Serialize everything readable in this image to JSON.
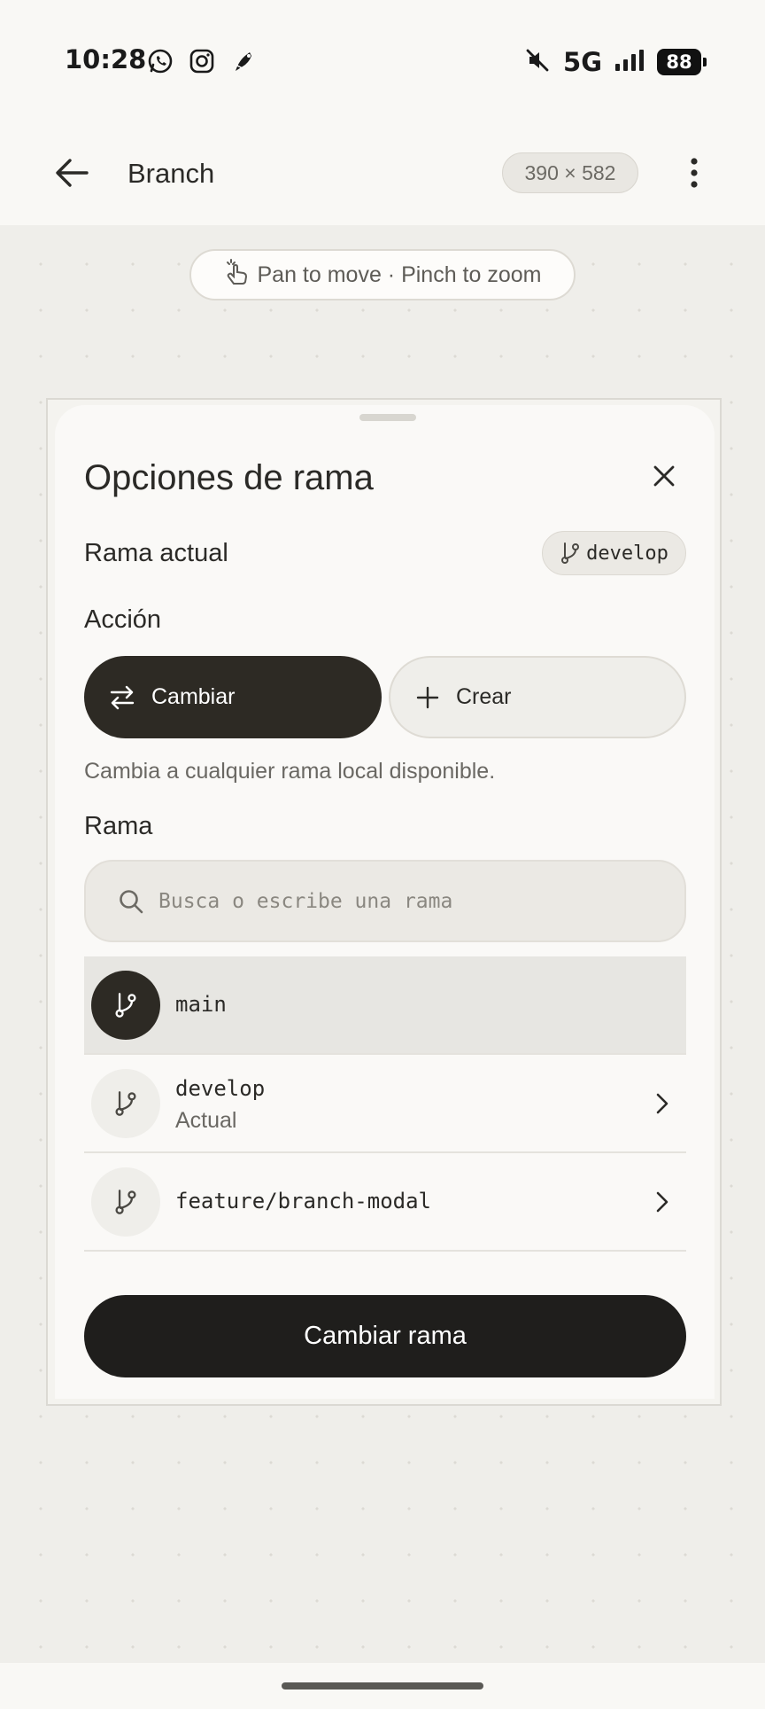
{
  "status_bar": {
    "time": "10:28",
    "app_icons": [
      "whatsapp-icon",
      "instagram-icon",
      "notification-app-icon"
    ],
    "network": "5G",
    "battery": "88",
    "sound": "muted"
  },
  "app_bar": {
    "title": "Branch",
    "dimensions": "390 × 582"
  },
  "canvas": {
    "hint": "Pan to move · Pinch to zoom"
  },
  "sheet": {
    "title": "Opciones de rama",
    "current_label": "Rama actual",
    "current_branch": "develop",
    "action_label": "Acción",
    "actions": [
      {
        "label": "Cambiar",
        "selected": true,
        "icon": "swap-icon"
      },
      {
        "label": "Crear",
        "selected": false,
        "icon": "plus-icon"
      }
    ],
    "helper_text": "Cambia a cualquier rama local disponible.",
    "branch_label": "Rama",
    "search_placeholder": "Busca o escribe una rama",
    "branches": [
      {
        "name": "main",
        "subtitle": "",
        "selected": true
      },
      {
        "name": "develop",
        "subtitle": "Actual",
        "selected": false
      },
      {
        "name": "feature/branch-modal",
        "subtitle": "",
        "selected": false
      }
    ],
    "primary_button": "Cambiar rama"
  },
  "colors": {
    "accent_dark": "#2d2a24",
    "background": "#f9f8f5",
    "canvas": "#efeeea"
  }
}
